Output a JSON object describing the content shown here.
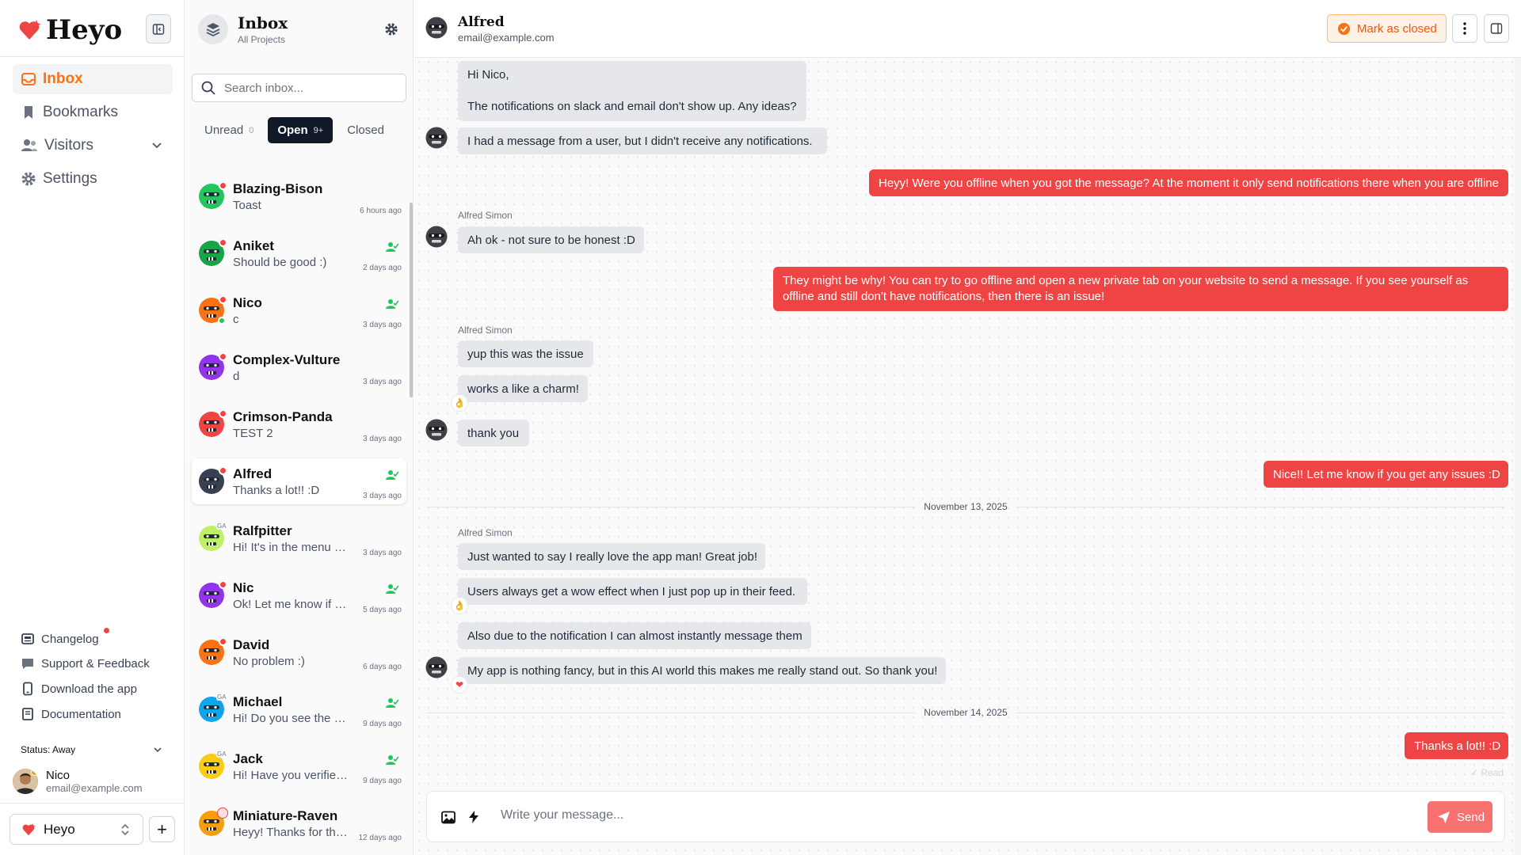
{
  "app": {
    "brand": "Heyo"
  },
  "nav": {
    "items": [
      {
        "label": "Inbox",
        "icon": "inbox-icon"
      },
      {
        "label": "Bookmarks",
        "icon": "bookmark-icon"
      },
      {
        "label": "Visitors",
        "icon": "users-icon"
      },
      {
        "label": "Settings",
        "icon": "gear-icon"
      }
    ],
    "footer_links": [
      {
        "label": "Changelog",
        "icon": "newspaper-icon"
      },
      {
        "label": "Support & Feedback",
        "icon": "chat-bubble-icon"
      },
      {
        "label": "Download the app",
        "icon": "phone-icon"
      },
      {
        "label": "Documentation",
        "icon": "book-icon"
      }
    ]
  },
  "user": {
    "status": "Status: Away",
    "name": "Nico",
    "email": "email@example.com"
  },
  "project": {
    "name": "Heyo"
  },
  "inbox": {
    "title": "Inbox",
    "subtitle": "All Projects",
    "search_placeholder": "Search inbox...",
    "tabs": [
      {
        "label": "Unread",
        "count": "0"
      },
      {
        "label": "Open",
        "count": "9+"
      },
      {
        "label": "Closed"
      }
    ],
    "conversations": [
      {
        "name": "Blazing-Bison",
        "preview": "Toast",
        "time": "6 hours ago",
        "avatar_color": "#22c55e",
        "badge": "new",
        "assigned": false
      },
      {
        "name": "Aniket",
        "preview": "Should be good :)",
        "time": "2 days ago",
        "avatar_color": "#16a34a",
        "badge": "new",
        "assigned": true
      },
      {
        "name": "Nico",
        "preview": "c",
        "time": "3 days ago",
        "avatar_color": "#f97316",
        "badge": "online",
        "assigned": true
      },
      {
        "name": "Complex-Vulture",
        "preview": "d",
        "time": "3 days ago",
        "avatar_color": "#9333ea",
        "badge": "new",
        "assigned": false
      },
      {
        "name": "Crimson-Panda",
        "preview": "TEST 2",
        "time": "3 days ago",
        "avatar_color": "#ef4444",
        "badge": "new",
        "assigned": false
      },
      {
        "name": "Alfred",
        "preview": "Thanks a lot!! :D",
        "time": "3 days ago",
        "avatar_color": "#374151",
        "badge": "new",
        "assigned": true,
        "selected": true
      },
      {
        "name": "Ralfpitter",
        "preview": "Hi! It's in the menu on the left",
        "time": "3 days ago",
        "avatar_color": "#bef264",
        "badge": "GA",
        "assigned": false
      },
      {
        "name": "Nic",
        "preview": "Ok! Let me know if you need more",
        "time": "5 days ago",
        "avatar_color": "#9333ea",
        "badge": "new",
        "assigned": true
      },
      {
        "name": "David",
        "preview": "No problem :)",
        "time": "6 days ago",
        "avatar_color": "#f97316",
        "badge": "new",
        "assigned": false
      },
      {
        "name": "Michael",
        "preview": "Hi! Do you see the chat now?",
        "time": "9 days ago",
        "avatar_color": "#0ea5e9",
        "badge": "GA",
        "assigned": true
      },
      {
        "name": "Jack",
        "preview": "Hi! Have you verified your domain?",
        "time": "9 days ago",
        "avatar_color": "#facc15",
        "badge": "GA",
        "assigned": true
      },
      {
        "name": "Miniature-Raven",
        "preview": "Heyy! Thanks for the message",
        "time": "12 days ago",
        "avatar_color": "#f59e0b",
        "badge": "multi",
        "assigned": false
      }
    ]
  },
  "chat": {
    "contact_name": "Alfred",
    "contact_email": "email@example.com",
    "mark_closed_label": "Mark as closed",
    "sender_name": "Alfred Simon",
    "messages": [
      {
        "line1": "Hi Nico,",
        "line2": "The notifications on slack and email don't show up. Any ideas?"
      },
      {
        "text": "I had a message from a user, but I didn't receive any notifications."
      },
      {
        "text": "Heyy! Were you offline when you got the message? At the moment it only send notifications there when you are offline"
      },
      {
        "text": "Ah ok - not sure to be honest :D"
      },
      {
        "text": "They might be why! You can try to go offline and open a new private tab on your website to send a message. If you see yourself as offline and still don't have notifications, then there is an issue!"
      },
      {
        "text": "yup this was the issue"
      },
      {
        "text": "works a like a charm!"
      },
      {
        "text": "thank you"
      },
      {
        "text": "Nice!! Let me know if you get any issues :D"
      },
      {
        "text": "Just wanted to say I really love the app man! Great job!"
      },
      {
        "text": "Users always get a wow effect when I just pop up in their feed."
      },
      {
        "text": "Also due to the notification I can almost instantly message them"
      },
      {
        "text": "My app is nothing fancy, but in this AI world this makes me really stand out. So thank you!"
      },
      {
        "text": "Thanks a lot!! :D"
      }
    ],
    "reactions": [
      "👌",
      "👌",
      "❤"
    ],
    "dates": [
      "November 13, 2025",
      "November 14, 2025"
    ],
    "read_label": "Read",
    "composer_placeholder": "Write your message...",
    "send_label": "Send"
  }
}
